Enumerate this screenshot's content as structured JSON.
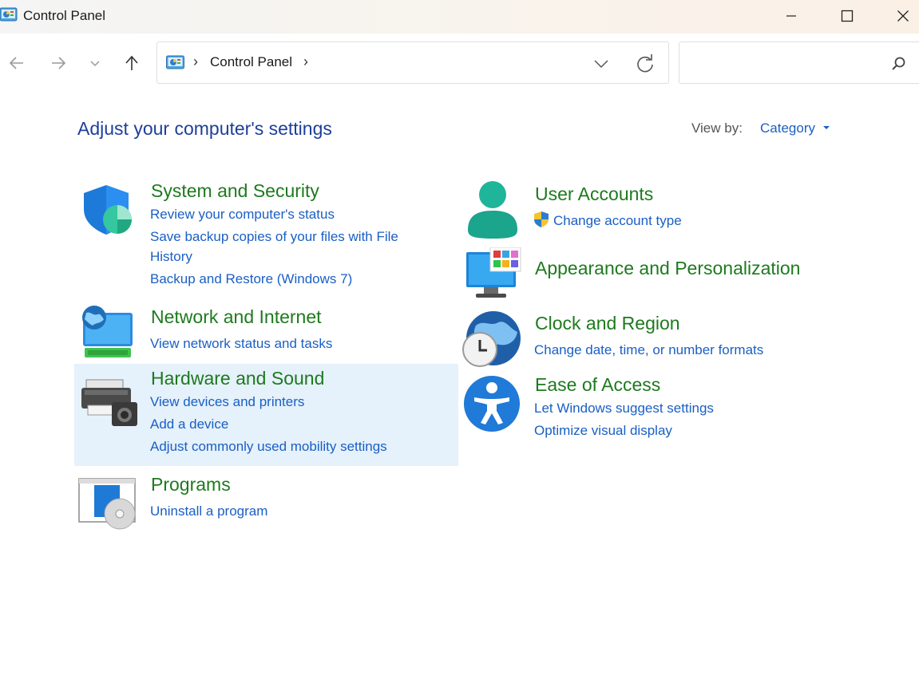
{
  "window": {
    "title": "Control Panel",
    "minimize_icon": "minimize-icon",
    "maximize_icon": "maximize-icon",
    "close_icon": "close-icon"
  },
  "nav": {
    "back_icon": "arrow-left-icon",
    "forward_icon": "arrow-right-icon",
    "recent_icon": "chevron-down-icon",
    "up_icon": "arrow-up-icon"
  },
  "address": {
    "root_separator": "›",
    "crumb": "Control Panel",
    "crumb_separator": "›"
  },
  "search": {
    "value": "",
    "placeholder": ""
  },
  "main": {
    "title": "Adjust your computer's settings",
    "view_by_label": "View by:",
    "view_by_value": "Category"
  },
  "categories": [
    {
      "title": "System and Security",
      "icon": "shield-icon",
      "links": [
        "Review your computer's status",
        "Save backup copies of your files with File",
        "History",
        "Backup and Restore (Windows 7)"
      ]
    },
    {
      "title": "Network and Internet",
      "icon": "network-globe-icon",
      "links": [
        "View network status and tasks"
      ]
    },
    {
      "title": "Hardware and Sound",
      "icon": "printer-speaker-icon",
      "links": [
        "View devices and printers",
        "Add a device",
        "Adjust commonly used mobility settings"
      ]
    },
    {
      "title": "Programs",
      "icon": "programs-disc-icon",
      "links": [
        "Uninstall a program"
      ]
    },
    {
      "title": "User Accounts",
      "icon": "user-icon",
      "links": [
        "Change account type"
      ],
      "link_icon": "uac-shield-icon"
    },
    {
      "title": "Appearance and Personalization",
      "icon": "monitor-palette-icon",
      "links": []
    },
    {
      "title": "Clock and Region",
      "icon": "globe-clock-icon",
      "links": [
        "Change date, time, or number formats"
      ]
    },
    {
      "title": "Ease of Access",
      "icon": "accessibility-icon",
      "links": [
        "Let Windows suggest settings",
        "Optimize visual display"
      ]
    }
  ],
  "colors": {
    "title_blue": "#1e3f9a",
    "category_green": "#1e7a1e",
    "link_blue": "#1a5fc4",
    "hover_bg": "#e5f1fb"
  }
}
